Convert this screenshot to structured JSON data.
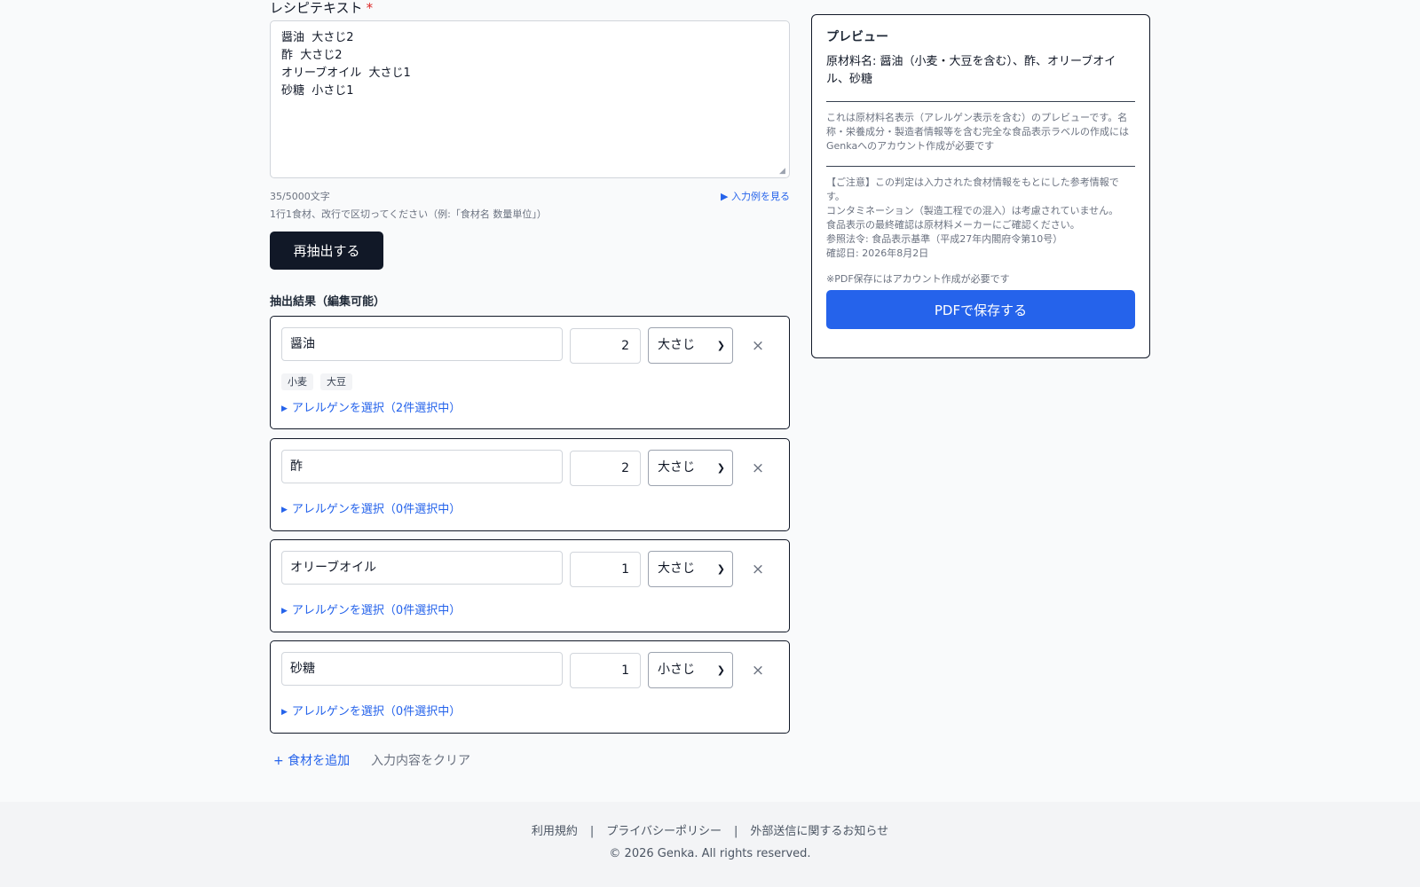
{
  "form": {
    "recipe_label": "レシピテキスト",
    "required_mark": "*",
    "recipe_text": "醤油  大さじ2\n酢  大さじ2\nオリーブオイル  大さじ1\n砂糖  小さじ1",
    "char_count": "35/5000文字",
    "example_link": "▶ 入力例を見る",
    "hint": "1行1食材、改行で区切ってください（例:「食材名 数量単位」）",
    "re_extract_button": "再抽出する",
    "results_title": "抽出結果（編集可能）"
  },
  "ingredients": [
    {
      "name": "醤油",
      "quantity": "2",
      "unit": "大さじ",
      "tags": [
        "小麦",
        "大豆"
      ],
      "allergen_toggle": "アレルゲンを選択（2件選択中）"
    },
    {
      "name": "酢",
      "quantity": "2",
      "unit": "大さじ",
      "tags": [],
      "allergen_toggle": "アレルゲンを選択（0件選択中）"
    },
    {
      "name": "オリーブオイル",
      "quantity": "1",
      "unit": "大さじ",
      "tags": [],
      "allergen_toggle": "アレルゲンを選択（0件選択中）"
    },
    {
      "name": "砂糖",
      "quantity": "1",
      "unit": "小さじ",
      "tags": [],
      "allergen_toggle": "アレルゲンを選択（0件選択中）"
    }
  ],
  "remove_icon": "×",
  "actions": {
    "add_ingredient": "+ 食材を追加",
    "clear_input": "入力内容をクリア"
  },
  "preview": {
    "title": "プレビュー",
    "ingredients_text": "原材料名: 醤油（小麦・大豆を含む）、酢、オリーブオイル、砂糖",
    "note": "これは原材料名表示（アレルゲン表示を含む）のプレビューです。名称・栄養成分・製造者情報等を含む完全な食品表示ラベルの作成にはGenkaへのアカウント作成が必要です",
    "disclaimer_1": "【ご注意】この判定は入力された食材情報をもとにした参考情報です。",
    "disclaimer_2": "コンタミネーション（製造工程での混入）は考慮されていません。",
    "disclaimer_3": "食品表示の最終確認は原材料メーカーにご確認ください。",
    "disclaimer_4": "参照法令: 食品表示基準（平成27年内閣府令第10号）",
    "disclaimer_5": "確認日: 2026年8月2日",
    "pdf_note": "※PDF保存にはアカウント作成が必要です",
    "pdf_button": "PDFで保存する"
  },
  "footer": {
    "terms": "利用規約",
    "privacy": "プライバシーポリシー",
    "external": "外部送信に関するお知らせ",
    "separator": "|",
    "copyright": "© 2026 Genka. All rights reserved."
  },
  "colors": {
    "primary_dark": "#111827",
    "accent_blue": "#2563eb",
    "required_red": "#dc2626"
  }
}
